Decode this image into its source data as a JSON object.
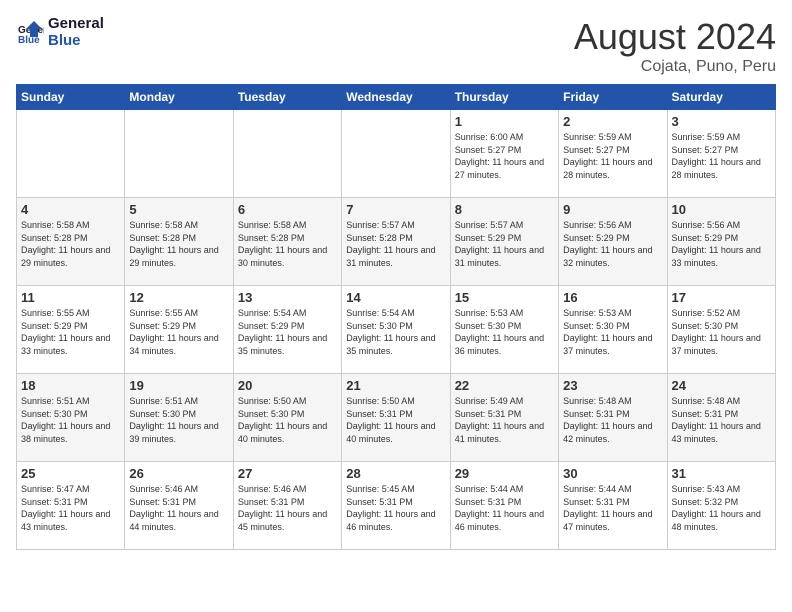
{
  "logo": {
    "line1": "General",
    "line2": "Blue"
  },
  "title": "August 2024",
  "subtitle": "Cojata, Puno, Peru",
  "days_of_week": [
    "Sunday",
    "Monday",
    "Tuesday",
    "Wednesday",
    "Thursday",
    "Friday",
    "Saturday"
  ],
  "weeks": [
    [
      {
        "day": "",
        "info": ""
      },
      {
        "day": "",
        "info": ""
      },
      {
        "day": "",
        "info": ""
      },
      {
        "day": "",
        "info": ""
      },
      {
        "day": "1",
        "info": "Sunrise: 6:00 AM\nSunset: 5:27 PM\nDaylight: 11 hours\nand 27 minutes."
      },
      {
        "day": "2",
        "info": "Sunrise: 5:59 AM\nSunset: 5:27 PM\nDaylight: 11 hours\nand 28 minutes."
      },
      {
        "day": "3",
        "info": "Sunrise: 5:59 AM\nSunset: 5:27 PM\nDaylight: 11 hours\nand 28 minutes."
      }
    ],
    [
      {
        "day": "4",
        "info": "Sunrise: 5:58 AM\nSunset: 5:28 PM\nDaylight: 11 hours\nand 29 minutes."
      },
      {
        "day": "5",
        "info": "Sunrise: 5:58 AM\nSunset: 5:28 PM\nDaylight: 11 hours\nand 29 minutes."
      },
      {
        "day": "6",
        "info": "Sunrise: 5:58 AM\nSunset: 5:28 PM\nDaylight: 11 hours\nand 30 minutes."
      },
      {
        "day": "7",
        "info": "Sunrise: 5:57 AM\nSunset: 5:28 PM\nDaylight: 11 hours\nand 31 minutes."
      },
      {
        "day": "8",
        "info": "Sunrise: 5:57 AM\nSunset: 5:29 PM\nDaylight: 11 hours\nand 31 minutes."
      },
      {
        "day": "9",
        "info": "Sunrise: 5:56 AM\nSunset: 5:29 PM\nDaylight: 11 hours\nand 32 minutes."
      },
      {
        "day": "10",
        "info": "Sunrise: 5:56 AM\nSunset: 5:29 PM\nDaylight: 11 hours\nand 33 minutes."
      }
    ],
    [
      {
        "day": "11",
        "info": "Sunrise: 5:55 AM\nSunset: 5:29 PM\nDaylight: 11 hours\nand 33 minutes."
      },
      {
        "day": "12",
        "info": "Sunrise: 5:55 AM\nSunset: 5:29 PM\nDaylight: 11 hours\nand 34 minutes."
      },
      {
        "day": "13",
        "info": "Sunrise: 5:54 AM\nSunset: 5:29 PM\nDaylight: 11 hours\nand 35 minutes."
      },
      {
        "day": "14",
        "info": "Sunrise: 5:54 AM\nSunset: 5:30 PM\nDaylight: 11 hours\nand 35 minutes."
      },
      {
        "day": "15",
        "info": "Sunrise: 5:53 AM\nSunset: 5:30 PM\nDaylight: 11 hours\nand 36 minutes."
      },
      {
        "day": "16",
        "info": "Sunrise: 5:53 AM\nSunset: 5:30 PM\nDaylight: 11 hours\nand 37 minutes."
      },
      {
        "day": "17",
        "info": "Sunrise: 5:52 AM\nSunset: 5:30 PM\nDaylight: 11 hours\nand 37 minutes."
      }
    ],
    [
      {
        "day": "18",
        "info": "Sunrise: 5:51 AM\nSunset: 5:30 PM\nDaylight: 11 hours\nand 38 minutes."
      },
      {
        "day": "19",
        "info": "Sunrise: 5:51 AM\nSunset: 5:30 PM\nDaylight: 11 hours\nand 39 minutes."
      },
      {
        "day": "20",
        "info": "Sunrise: 5:50 AM\nSunset: 5:30 PM\nDaylight: 11 hours\nand 40 minutes."
      },
      {
        "day": "21",
        "info": "Sunrise: 5:50 AM\nSunset: 5:31 PM\nDaylight: 11 hours\nand 40 minutes."
      },
      {
        "day": "22",
        "info": "Sunrise: 5:49 AM\nSunset: 5:31 PM\nDaylight: 11 hours\nand 41 minutes."
      },
      {
        "day": "23",
        "info": "Sunrise: 5:48 AM\nSunset: 5:31 PM\nDaylight: 11 hours\nand 42 minutes."
      },
      {
        "day": "24",
        "info": "Sunrise: 5:48 AM\nSunset: 5:31 PM\nDaylight: 11 hours\nand 43 minutes."
      }
    ],
    [
      {
        "day": "25",
        "info": "Sunrise: 5:47 AM\nSunset: 5:31 PM\nDaylight: 11 hours\nand 43 minutes."
      },
      {
        "day": "26",
        "info": "Sunrise: 5:46 AM\nSunset: 5:31 PM\nDaylight: 11 hours\nand 44 minutes."
      },
      {
        "day": "27",
        "info": "Sunrise: 5:46 AM\nSunset: 5:31 PM\nDaylight: 11 hours\nand 45 minutes."
      },
      {
        "day": "28",
        "info": "Sunrise: 5:45 AM\nSunset: 5:31 PM\nDaylight: 11 hours\nand 46 minutes."
      },
      {
        "day": "29",
        "info": "Sunrise: 5:44 AM\nSunset: 5:31 PM\nDaylight: 11 hours\nand 46 minutes."
      },
      {
        "day": "30",
        "info": "Sunrise: 5:44 AM\nSunset: 5:31 PM\nDaylight: 11 hours\nand 47 minutes."
      },
      {
        "day": "31",
        "info": "Sunrise: 5:43 AM\nSunset: 5:32 PM\nDaylight: 11 hours\nand 48 minutes."
      }
    ]
  ]
}
